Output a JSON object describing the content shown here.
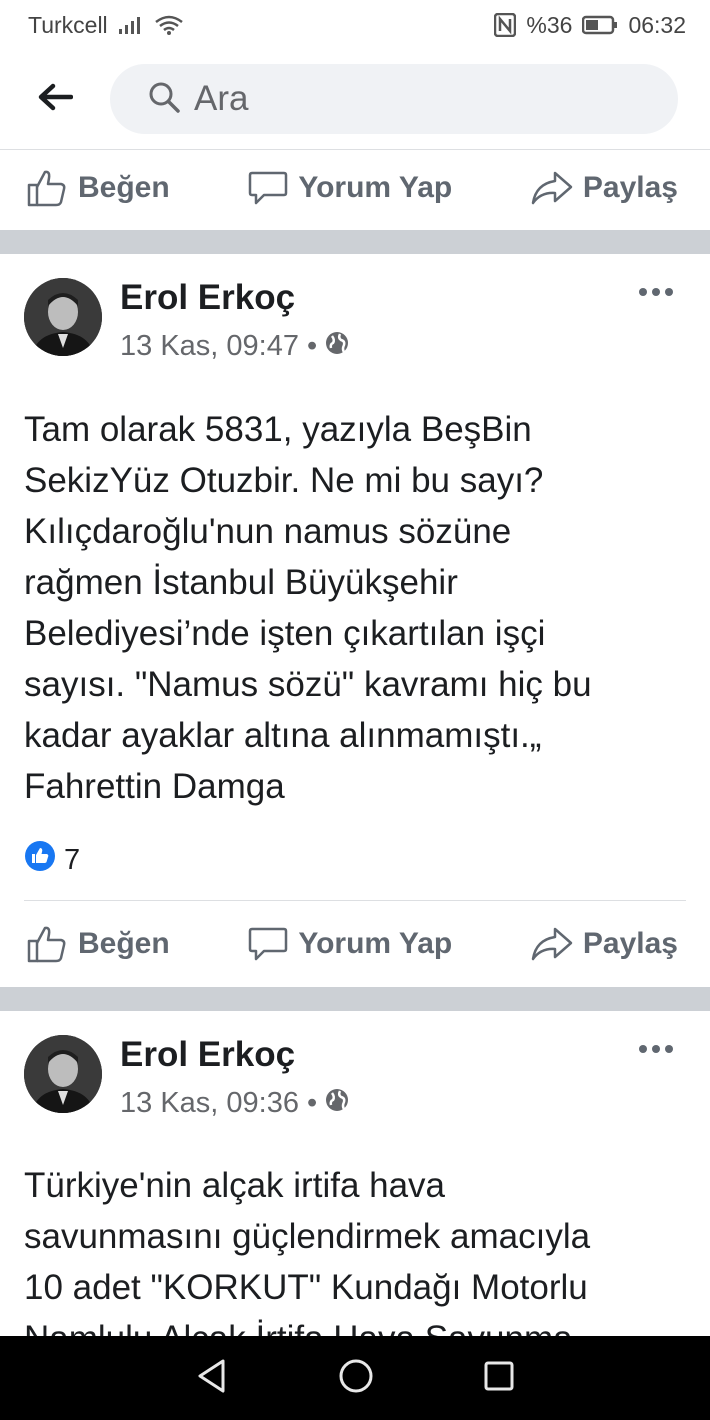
{
  "status": {
    "carrier": "Turkcell",
    "battery": "%36",
    "time": "06:32",
    "icons": [
      "signal-icon",
      "wifi-icon",
      "nfc-icon",
      "battery-icon"
    ]
  },
  "search": {
    "placeholder": "Ara"
  },
  "actions": {
    "like": "Beğen",
    "comment": "Yorum Yap",
    "share": "Paylaş"
  },
  "posts": [
    {
      "author": "Erol Erkoç",
      "time": "13 Kas, 09:47",
      "dot": "•",
      "text": "Tam olarak 5831, yazıyla BeşBin\nSekizYüz Otuzbir. Ne mi bu sayı?\nKılıçdaroğlu'nun namus sözüne\nrağmen İstanbul Büyükşehir\nBelediyesi’nde işten çıkartılan işçi\nsayısı. \"Namus sözü\" kavramı hiç bu\nkadar ayaklar altına alınmamıştı.„\nFahrettin Damga",
      "reaction_count": "7"
    },
    {
      "author": "Erol Erkoç",
      "time": "13 Kas, 09:36",
      "dot": "•",
      "text": "Türkiye'nin alçak irtifa hava\nsavunmasını güçlendirmek amacıyla\n10 adet \"KORKUT\" Kundağı Motorlu\nNamlulu Alçak İrtifa Hava Savunma"
    }
  ],
  "colors": {
    "accent": "#1877f2",
    "text": "#1c1e21",
    "muted": "#65676b",
    "action": "#606770",
    "separator": "#ccd0d5"
  }
}
